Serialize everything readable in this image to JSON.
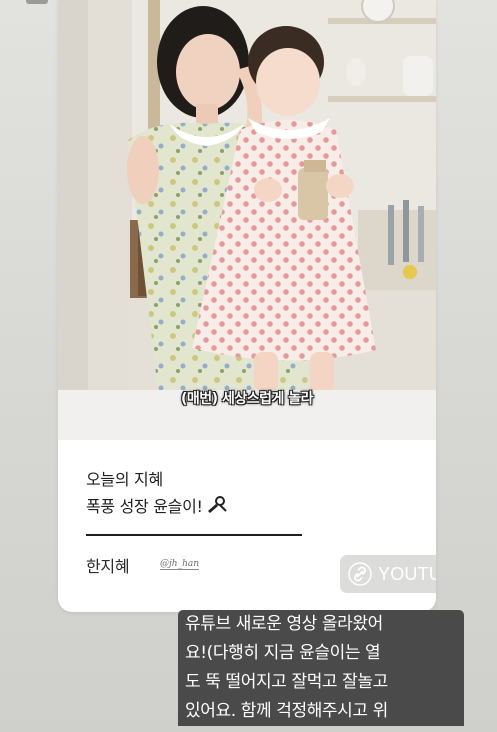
{
  "story": {
    "video": {
      "subtitle": "(매번) 세상스럽게 놀라"
    },
    "caption": {
      "line1": "오늘의 지혜",
      "line2": "폭풍 성장 윤슬이!"
    },
    "author": {
      "name": "한지혜",
      "handle": "@jh_han"
    },
    "link_sticker": {
      "label": "YOUTU.BE",
      "icon": "link-icon"
    },
    "text_overlay": {
      "lines": [
        "유튜브 새로운 영상 올라왔어",
        "요!(다행히 지금 윤슬이는 열",
        "도 뚝 떨어지고 잘먹고 잘놀고",
        "있어요. 함께 걱정해주시고 위"
      ]
    }
  }
}
